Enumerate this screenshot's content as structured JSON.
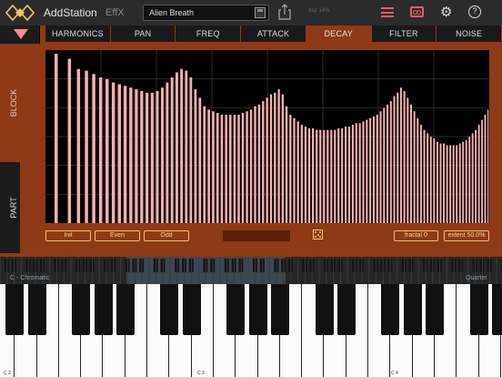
{
  "header": {
    "app_title": "AddStation",
    "fx_tab": "EffX",
    "preset_name": "Alien Breath",
    "status_text": "dsp 14%",
    "icons": [
      "logo-icon",
      "save-icon",
      "share-icon",
      "menu-icon",
      "tape-icon",
      "gear-icon",
      "help-icon"
    ],
    "accent_color": "#e85a6c"
  },
  "tabs": [
    "HARMONICS",
    "PAN",
    "FREQ",
    "ATTACK",
    "DECAY",
    "FILTER",
    "NOISE"
  ],
  "active_tab": "DECAY",
  "side_tabs": {
    "block": "BLOCK",
    "part": "PART"
  },
  "controls": {
    "init": "Init",
    "even": "Even",
    "odd": "Odd",
    "fractal": "fractal 0",
    "extent": "extent 50.0%"
  },
  "keyboard": {
    "scale": "C - Chromatic",
    "tuning": "Quarter",
    "notes": [
      "C 2",
      "C 3",
      "C 4"
    ]
  },
  "chart_data": {
    "type": "bar",
    "title": "",
    "xlabel": "",
    "ylabel": "",
    "ylim": [
      0,
      1
    ],
    "bar_color": "#f4b0b0",
    "grid": true,
    "values": [
      1.0,
      0.97,
      0.91,
      0.9,
      0.88,
      0.86,
      0.85,
      0.83,
      0.82,
      0.81,
      0.8,
      0.79,
      0.78,
      0.77,
      0.77,
      0.78,
      0.8,
      0.83,
      0.86,
      0.89,
      0.91,
      0.9,
      0.86,
      0.79,
      0.74,
      0.69,
      0.67,
      0.66,
      0.65,
      0.64,
      0.64,
      0.64,
      0.64,
      0.64,
      0.65,
      0.66,
      0.67,
      0.69,
      0.7,
      0.72,
      0.74,
      0.76,
      0.77,
      0.79,
      0.76,
      0.69,
      0.64,
      0.62,
      0.6,
      0.58,
      0.57,
      0.56,
      0.56,
      0.55,
      0.55,
      0.55,
      0.55,
      0.55,
      0.55,
      0.56,
      0.56,
      0.57,
      0.57,
      0.58,
      0.59,
      0.59,
      0.6,
      0.61,
      0.62,
      0.63,
      0.64,
      0.66,
      0.68,
      0.7,
      0.72,
      0.75,
      0.77,
      0.8,
      0.78,
      0.74,
      0.7,
      0.66,
      0.62,
      0.58,
      0.55,
      0.53,
      0.51,
      0.5,
      0.48,
      0.47,
      0.47,
      0.46,
      0.46,
      0.46,
      0.46,
      0.47,
      0.48,
      0.49,
      0.51,
      0.53,
      0.55,
      0.58,
      0.61,
      0.64,
      0.67
    ]
  }
}
